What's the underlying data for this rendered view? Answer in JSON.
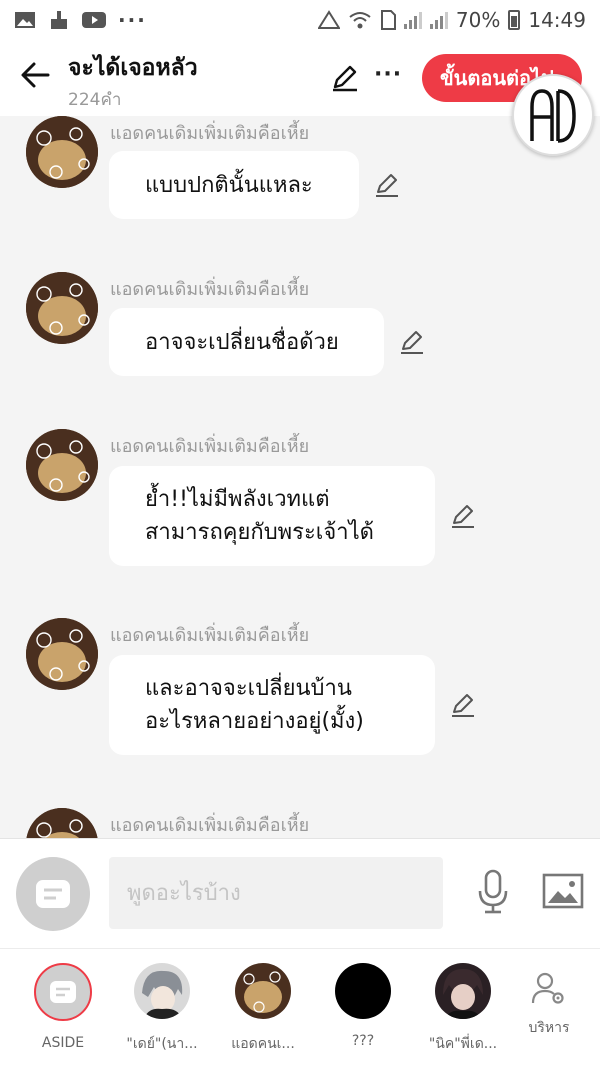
{
  "status_bar": {
    "more": "···",
    "battery": "70%",
    "time": "14:49"
  },
  "header": {
    "title": "จะได้เจอหลัว",
    "word_count": "224คำ",
    "more": "···",
    "next_button": "ขั้นตอนต่อไป",
    "logo_text": "AD"
  },
  "messages": [
    {
      "sender": "แอดคนเดิมเพิ่มเติมคือเหี้ย",
      "text": "แบบปกตินั้นแหละ"
    },
    {
      "sender": "แอดคนเดิมเพิ่มเติมคือเหี้ย",
      "text": "อาจจะเปลี่ยนชื่อด้วย"
    },
    {
      "sender": "แอดคนเดิมเพิ่มเติมคือเหี้ย",
      "line1": "ย้ำ!!ไม่มีพลังเวทแต่",
      "line2": "สามารถคุยกับพระเจ้าได้"
    },
    {
      "sender": "แอดคนเดิมเพิ่มเติมคือเหี้ย",
      "line1": "และอาจจะเปลี่ยนบ้าน",
      "line2": "อะไรหลายอย่างอยู่(มั้ง)"
    },
    {
      "sender": "แอดคนเดิมเพิ่มเติมคือเหี้ย"
    }
  ],
  "composer": {
    "placeholder": "พูดอะไรบ้าง"
  },
  "bottom_tabs": [
    {
      "label": "ASIDE",
      "icon": "aside-icon"
    },
    {
      "label": "\"เดย์\"(นา..."
    },
    {
      "label": "แอดคนเ..."
    },
    {
      "label": "???"
    },
    {
      "label": "\"นิค\"พี่เด..."
    },
    {
      "label": "บริหาร",
      "icon": "manage-user-icon"
    }
  ],
  "colors": {
    "accent": "#ee3b46",
    "background": "#f4f4f4"
  }
}
